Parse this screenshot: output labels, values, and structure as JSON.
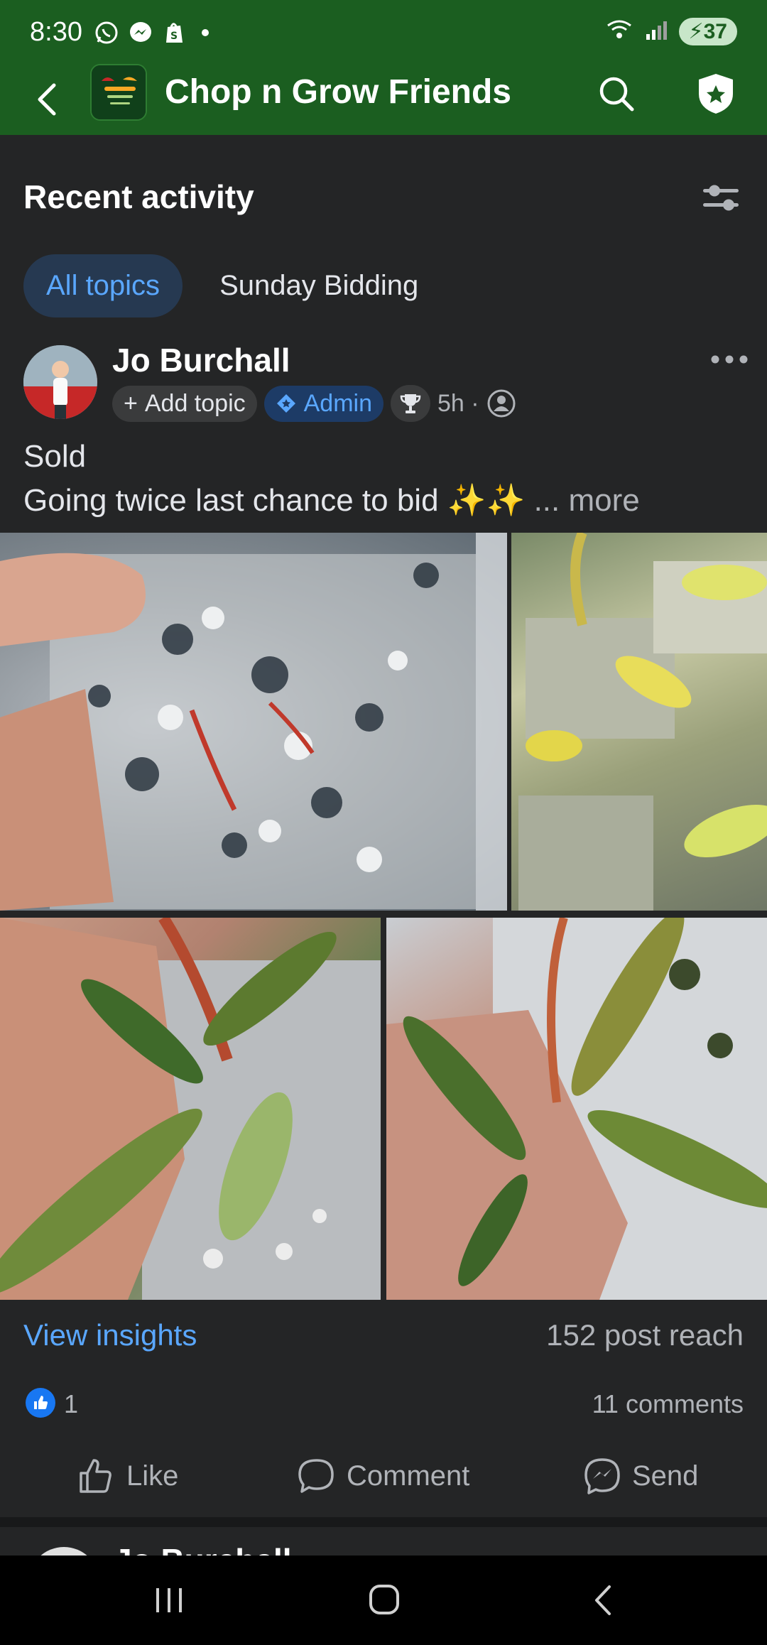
{
  "status_bar": {
    "time": "8:30",
    "battery": "37",
    "notification_icons": [
      "whatsapp-icon",
      "messenger-icon",
      "shopify-icon"
    ]
  },
  "header": {
    "title": "Chop n Grow Friends"
  },
  "section": {
    "title": "Recent activity"
  },
  "tabs": [
    {
      "label": "All topics",
      "active": true
    },
    {
      "label": "Sunday Bidding",
      "active": false
    }
  ],
  "post": {
    "author": "Jo Burchall",
    "add_topic_label": "Add topic",
    "admin_label": "Admin",
    "time": "5h",
    "text_line1": "Sold",
    "text_line2": "Going twice last chance to bid ✨✨",
    "more_label": "... more",
    "insights_label": "View insights",
    "reach": "152 post reach",
    "like_count": "1",
    "comments": "11 comments",
    "actions": {
      "like": "Like",
      "comment": "Comment",
      "send": "Send"
    }
  },
  "next_post": {
    "author": "Jo Burchall"
  },
  "colors": {
    "header_bg": "#1b5e20",
    "page_bg": "#242526",
    "accent": "#5aa7ff",
    "like_blue": "#1877f2"
  }
}
